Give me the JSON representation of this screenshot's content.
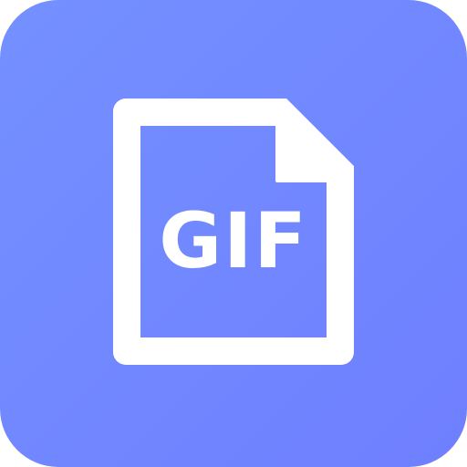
{
  "app_icon": {
    "label": "GIF",
    "icon": "gif-file-icon",
    "background_colors": [
      "#7490FF",
      "#6F7FFF"
    ],
    "foreground_color": "#FFFFFF"
  }
}
